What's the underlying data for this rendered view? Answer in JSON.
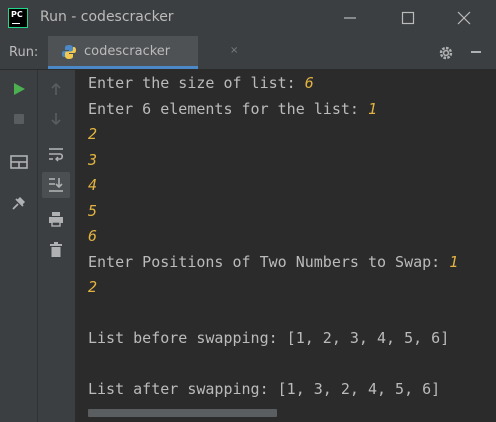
{
  "window": {
    "app_icon_text": "PC",
    "title": "Run - codescracker"
  },
  "toolbar": {
    "run_label": "Run:",
    "tab_label": "codescracker",
    "tab_close": "×"
  },
  "colors": {
    "background": "#2b2b2b",
    "panel": "#3c3f41",
    "text": "#bbbbbb",
    "user_input": "#e3b341",
    "run_green": "#4caf50",
    "tab_accent": "#4a88c7"
  },
  "console": {
    "lines": [
      {
        "prompt": "Enter the size of list: ",
        "input": "6"
      },
      {
        "prompt": "Enter 6 elements for the list: ",
        "input": "1"
      },
      {
        "prompt": "",
        "input": "2"
      },
      {
        "prompt": "",
        "input": "3"
      },
      {
        "prompt": "",
        "input": "4"
      },
      {
        "prompt": "",
        "input": "5"
      },
      {
        "prompt": "",
        "input": "6"
      },
      {
        "prompt": "Enter Positions of Two Numbers to Swap: ",
        "input": "1"
      },
      {
        "prompt": "",
        "input": "2"
      },
      {
        "prompt": "",
        "input": ""
      },
      {
        "prompt": "List before swapping: [1, 2, 3, 4, 5, 6]",
        "input": ""
      },
      {
        "prompt": "",
        "input": ""
      },
      {
        "prompt": "List after swapping: [1, 3, 2, 4, 5, 6]",
        "input": ""
      }
    ]
  }
}
